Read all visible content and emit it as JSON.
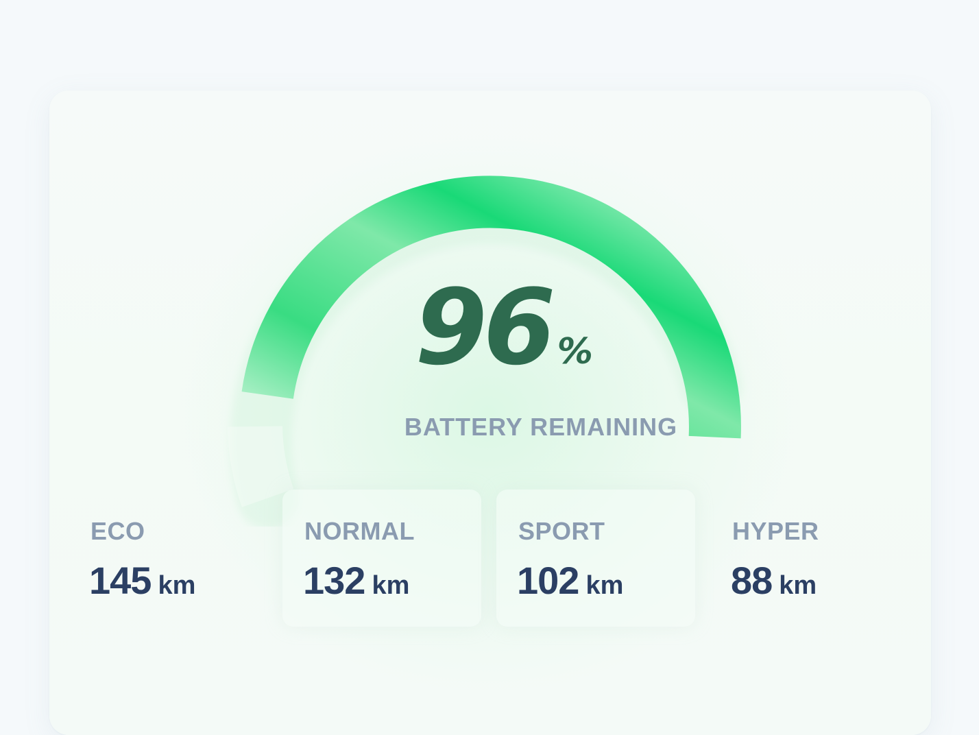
{
  "battery": {
    "percent": 96,
    "value": "96",
    "unit": "%",
    "label": "BATTERY REMAINING"
  },
  "modes": [
    {
      "name": "ECO",
      "range": "145",
      "unit": "km"
    },
    {
      "name": "NORMAL",
      "range": "132",
      "unit": "km"
    },
    {
      "name": "SPORT",
      "range": "102",
      "unit": "km"
    },
    {
      "name": "HYPER",
      "range": "88",
      "unit": "km"
    }
  ],
  "colors": {
    "accent": "#19d977",
    "accent_light": "#a8f0c4",
    "value_text": "#2e6b4f",
    "label_text": "#8a9bb0",
    "range_text": "#2b3f63",
    "background": "#f5f9fb"
  }
}
